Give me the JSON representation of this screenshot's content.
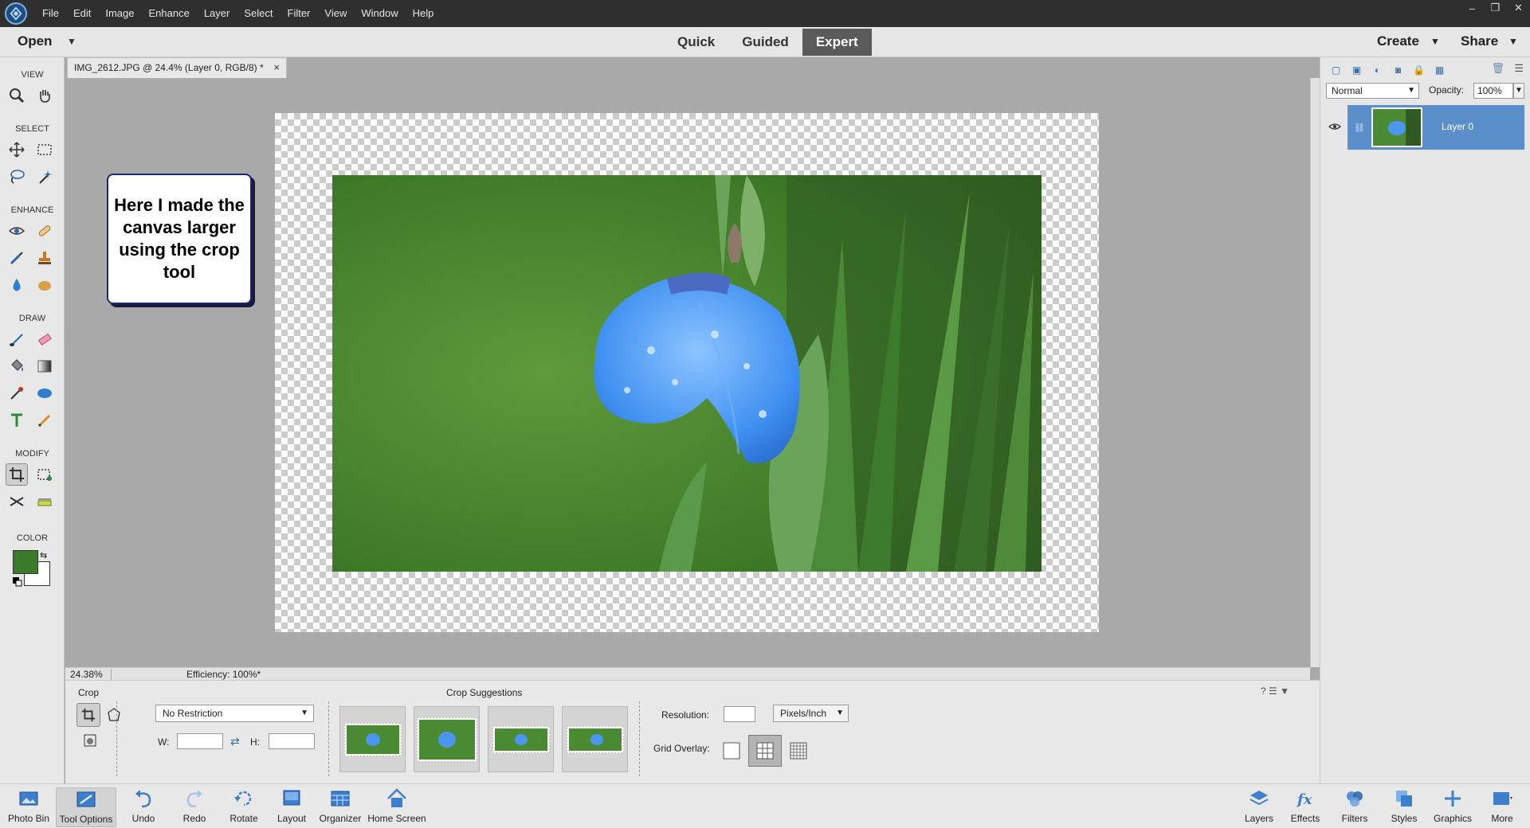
{
  "menu": {
    "items": [
      "File",
      "Edit",
      "Image",
      "Enhance",
      "Layer",
      "Select",
      "Filter",
      "View",
      "Window",
      "Help"
    ]
  },
  "window_controls": {
    "minimize": "–",
    "restore": "❐",
    "close": "✕"
  },
  "topbar": {
    "open_label": "Open",
    "modes": [
      "Quick",
      "Guided",
      "Expert"
    ],
    "active_mode": "Expert",
    "create_label": "Create",
    "share_label": "Share"
  },
  "toolbox": {
    "sections": [
      "VIEW",
      "SELECT",
      "ENHANCE",
      "DRAW",
      "MODIFY",
      "COLOR"
    ],
    "foreground_color": "#3b7a2a",
    "background_color": "#ffffff"
  },
  "document": {
    "tab_title": "IMG_2612.JPG @ 24.4% (Layer 0, RGB/8) *",
    "close_glyph": "×"
  },
  "callout": {
    "text": "Here I made the canvas larger using the crop tool"
  },
  "status": {
    "zoom": "24.38%",
    "efficiency": "Efficiency: 100%*"
  },
  "layers_panel": {
    "blend_mode": "Normal",
    "opacity_label": "Opacity:",
    "opacity_value": "100%",
    "layer_name": "Layer 0"
  },
  "tool_options": {
    "title": "Crop",
    "ratio": "No Restriction",
    "w_label": "W:",
    "h_label": "H:",
    "suggestions_title": "Crop Suggestions",
    "resolution_label": "Resolution:",
    "resolution_unit": "Pixels/Inch",
    "grid_label": "Grid Overlay:"
  },
  "bottombar": {
    "left": [
      "Photo Bin",
      "Tool Options",
      "Undo",
      "Redo",
      "Rotate",
      "Layout",
      "Organizer",
      "Home Screen"
    ],
    "right": [
      "Layers",
      "Effects",
      "Filters",
      "Styles",
      "Graphics",
      "More"
    ]
  },
  "colors": {
    "accent": "#5b8fc9",
    "menubar": "#2f2f2f",
    "canvas_bg": "#a9a9a9"
  }
}
